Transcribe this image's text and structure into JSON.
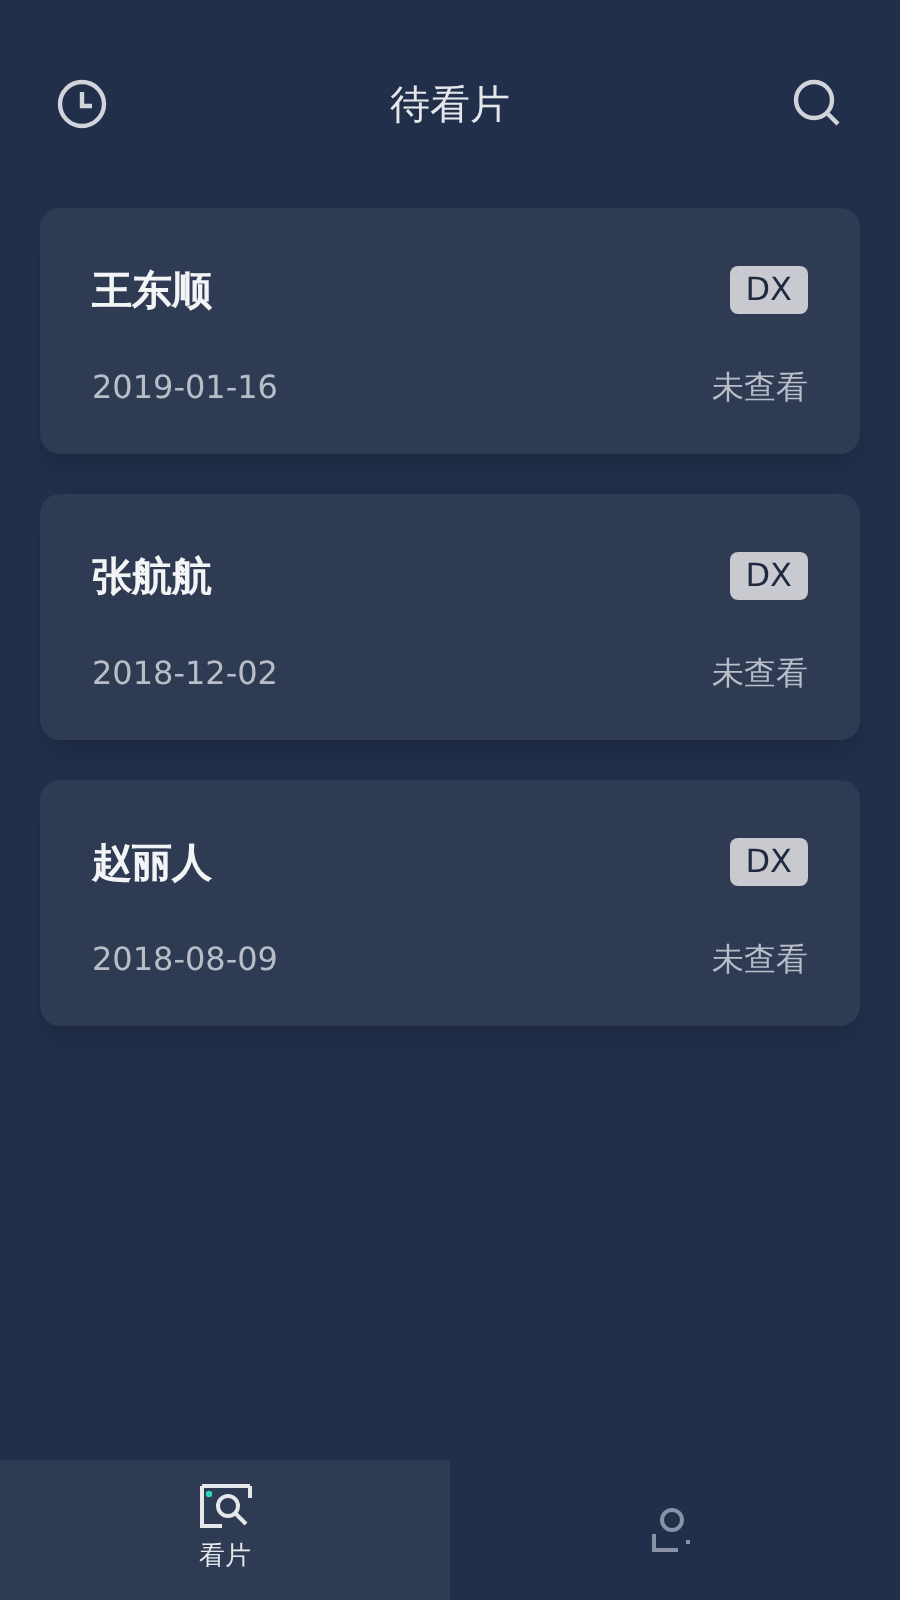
{
  "header": {
    "title": "待看片"
  },
  "records": [
    {
      "name": "王东顺",
      "badge": "DX",
      "date": "2019-01-16",
      "status": "未查看"
    },
    {
      "name": "张航航",
      "badge": "DX",
      "date": "2018-12-02",
      "status": "未查看"
    },
    {
      "name": "赵丽人",
      "badge": "DX",
      "date": "2018-08-09",
      "status": "未查看"
    }
  ],
  "tabs": [
    {
      "kind": "films",
      "label": "看片",
      "selected": true
    },
    {
      "kind": "profile",
      "selected": false
    }
  ]
}
